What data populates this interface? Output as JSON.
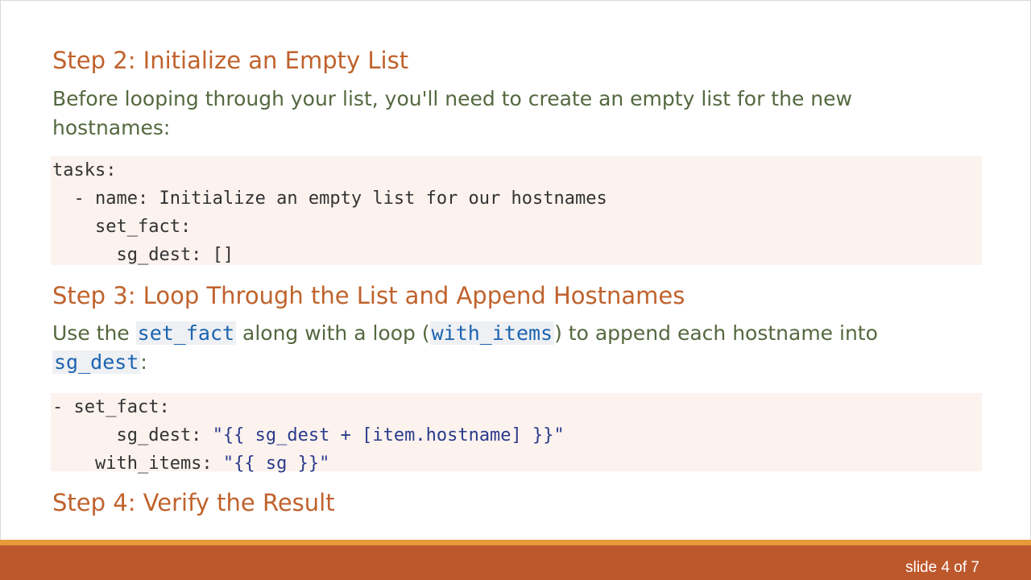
{
  "step2": {
    "heading": "Step 2: Initialize an Empty List",
    "paragraph": "Before looping through your list, you'll need to create an empty list for the new hostnames:",
    "code": [
      "tasks:",
      "  - name: Initialize an empty list for our hostnames",
      "    set_fact:",
      "      sg_dest: []"
    ]
  },
  "step3": {
    "heading": "Step 3: Loop Through the List and Append Hostnames",
    "para_t1": "Use the ",
    "para_c1": "set_fact",
    "para_t2": " along with a loop (",
    "para_c2": "with_items",
    "para_t3": ") to append each hostname into ",
    "para_c3": "sg_dest",
    "para_t4": ":",
    "code": {
      "l1": "- set_fact:",
      "l2_key": "      sg_dest: ",
      "l2_val": "\"{{ sg_dest + [item.hostname] }}\"",
      "l3_key": "    with_items: ",
      "l3_val": "\"{{ sg }}\""
    }
  },
  "step4": {
    "heading": "Step 4: Verify the Result"
  },
  "footer": {
    "slide_number": "slide 4 of 7"
  },
  "colors": {
    "heading": "#c0622c",
    "body_text": "#54683f",
    "inline_code": "#1c64b0",
    "code_bg": "#fcf2ee",
    "footer_accent": "#e79a3a",
    "footer_bar": "#bd582c"
  }
}
